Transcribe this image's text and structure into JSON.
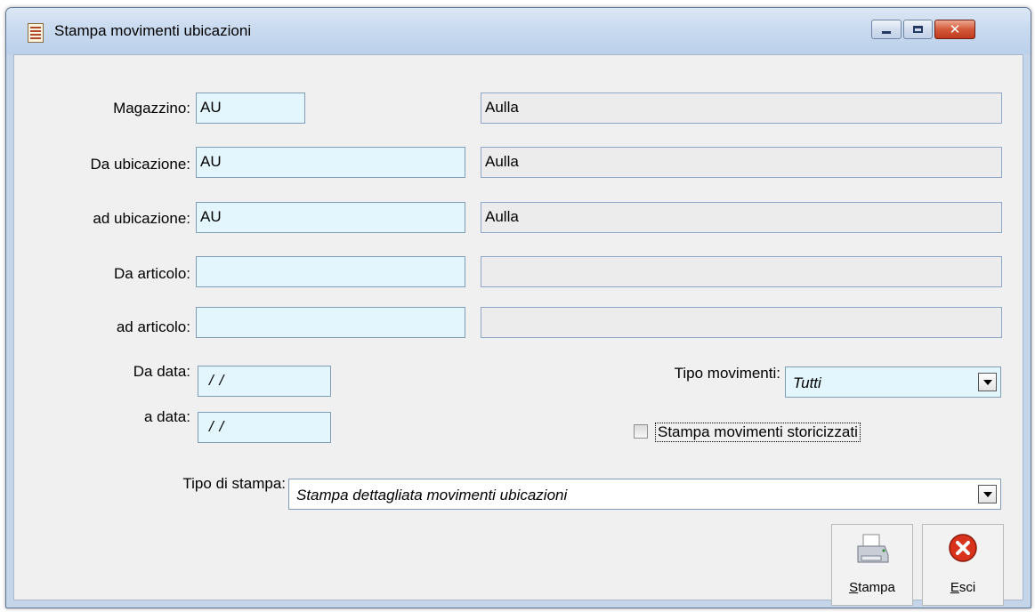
{
  "window": {
    "title": "Stampa movimenti ubicazioni"
  },
  "form": {
    "magazzino": {
      "label": "Magazzino:",
      "value": "AU",
      "description": "Aulla"
    },
    "da_ubicazione": {
      "label": "Da ubicazione:",
      "value": "AU",
      "description": "Aulla"
    },
    "ad_ubicazione": {
      "label": "ad ubicazione:",
      "value": "AU",
      "description": "Aulla"
    },
    "da_articolo": {
      "label": "Da articolo:",
      "value": "",
      "description": ""
    },
    "ad_articolo": {
      "label": "ad articolo:",
      "value": "",
      "description": ""
    },
    "da_data": {
      "label": "Da data:",
      "value": "/ /"
    },
    "a_data": {
      "label": "a data:",
      "value": "/ /"
    },
    "tipo_movimenti": {
      "label": "Tipo movimenti:",
      "selected": "Tutti"
    },
    "storicizzati": {
      "label": "Stampa movimenti storicizzati",
      "checked": false
    },
    "tipo_stampa": {
      "label": "Tipo di stampa:",
      "selected": "Stampa dettagliata movimenti ubicazioni"
    }
  },
  "buttons": {
    "stampa": {
      "accel": "S",
      "rest": "tampa",
      "icon": "printer-icon"
    },
    "esci": {
      "accel": "E",
      "rest": "sci",
      "icon": "exit-icon"
    }
  },
  "colors": {
    "edit_bg": "#e3f6fd",
    "readonly_bg": "#ececec",
    "border": "#7f9db9",
    "close": "#c13a1d"
  }
}
